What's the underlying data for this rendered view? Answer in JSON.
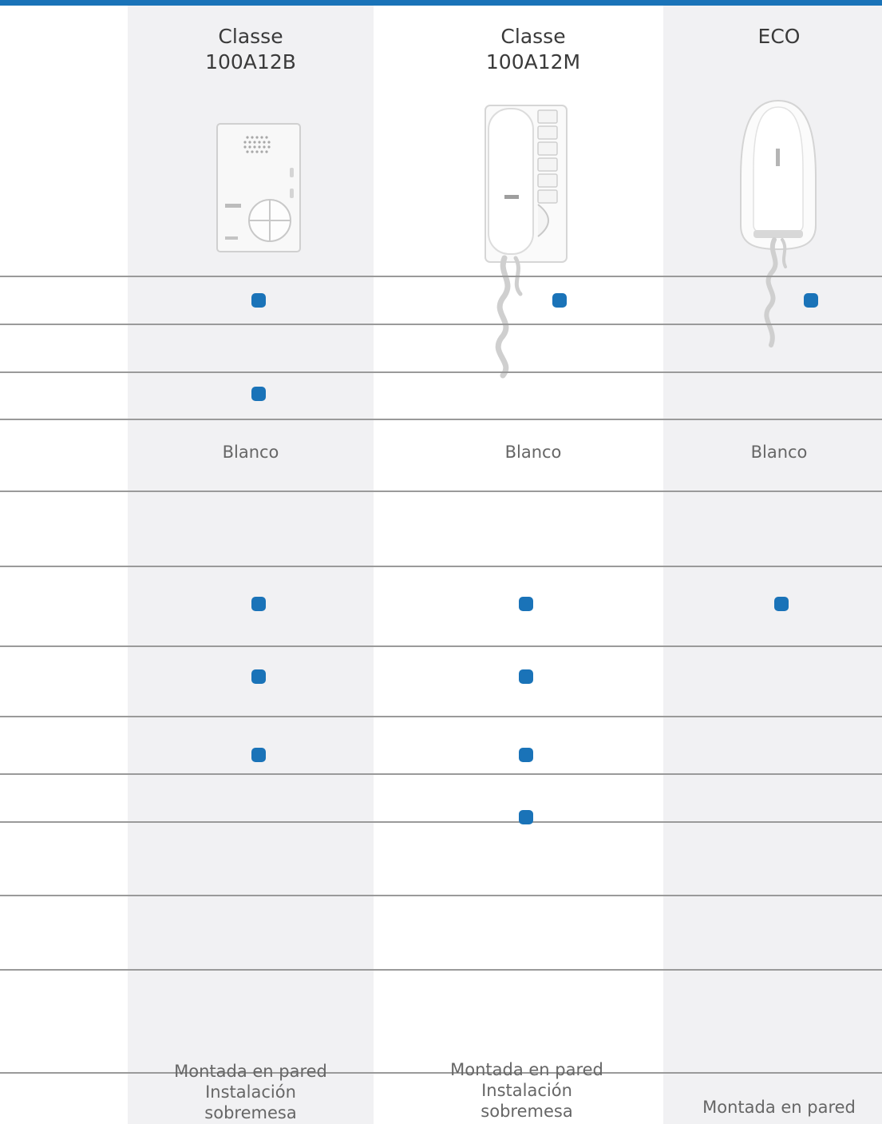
{
  "columns": [
    {
      "title_line1": "Classe",
      "title_line2": "100A12B"
    },
    {
      "title_line1": "Classe",
      "title_line2": "100A12M"
    },
    {
      "title_line1": "ECO",
      "title_line2": ""
    }
  ],
  "rows": [
    {
      "type": "dots",
      "marks": [
        true,
        true,
        true
      ]
    },
    {
      "type": "dots",
      "marks": [
        false,
        false,
        false
      ]
    },
    {
      "type": "dots",
      "marks": [
        true,
        false,
        false
      ]
    },
    {
      "type": "text",
      "values": [
        "Blanco",
        "Blanco",
        "Blanco"
      ]
    },
    {
      "type": "dots",
      "marks": [
        false,
        false,
        false
      ]
    },
    {
      "type": "dots",
      "marks": [
        true,
        true,
        true
      ]
    },
    {
      "type": "dots",
      "marks": [
        true,
        true,
        false
      ]
    },
    {
      "type": "dots",
      "marks": [
        true,
        true,
        false
      ]
    },
    {
      "type": "dots",
      "marks": [
        false,
        true,
        false
      ]
    },
    {
      "type": "dots",
      "marks": [
        false,
        false,
        false
      ]
    },
    {
      "type": "dots",
      "marks": [
        false,
        false,
        false
      ]
    },
    {
      "type": "dots",
      "marks": [
        false,
        false,
        false
      ]
    }
  ],
  "installation": [
    [
      "Montada en pared",
      "Instalación",
      "sobremesa"
    ],
    [
      "Montada en pared",
      "Instalación",
      "sobremesa"
    ],
    [
      "Montada en pared"
    ]
  ],
  "colors": {
    "accent": "#1a73b8",
    "column_shade": "#f1f1f3",
    "rule": "#9a9a9a"
  },
  "images": [
    "intercom-100A12B",
    "intercom-100A12M-handset",
    "intercom-ECO-handset"
  ]
}
